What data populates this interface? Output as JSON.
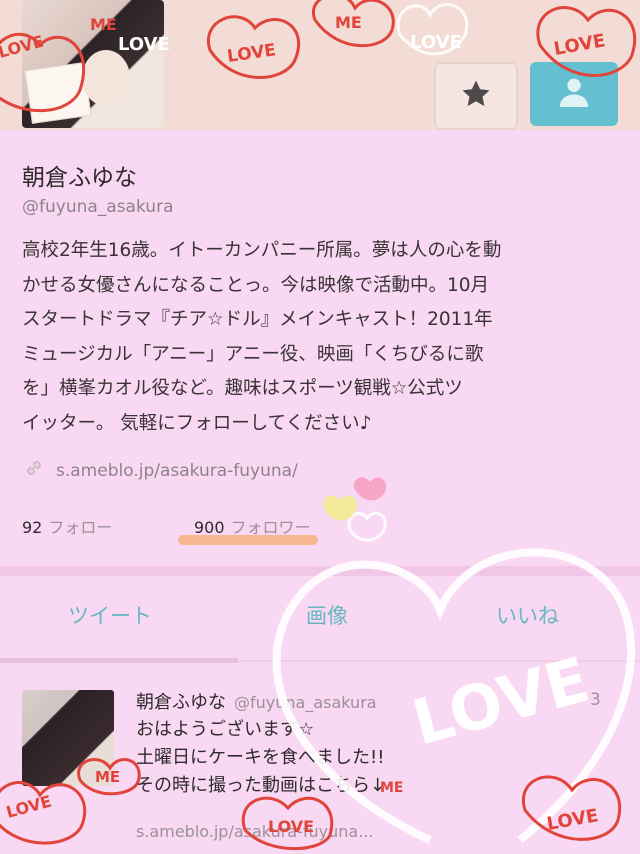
{
  "profile": {
    "name": "朝倉ふゆな",
    "handle": "@fuyuna_asakura",
    "bio": "高校2年生16歳。イトーカンパニー所属。夢は人の心を動\nかせる女優さんになることっ。今は映像で活動中。10月\nスタートドラマ『チア☆ドル』メインキャスト！2011年\nミュージカル「アニー」アニー役、映画「くちびるに歌\nを」横峯カオル役など。趣味はスポーツ観戦☆公式ツ\nイッター。 気軽にフォローしてください♪",
    "link": "s.ameblo.jp/asakura-fuyuna/"
  },
  "stats": {
    "following_count": "92",
    "following_label": "フォロー",
    "followers_count": "900",
    "followers_label": "フォロワー"
  },
  "tabs": [
    {
      "label": "ツイート"
    },
    {
      "label": "画像"
    },
    {
      "label": "いいね"
    }
  ],
  "tweet": {
    "name": "朝倉ふゆな",
    "handle": "@fuyuna_asakura",
    "time": "3",
    "text": "おはようございます☆\n土曜日にケーキを食べました!!\nその時に撮った動画はこちら↓",
    "link": "s.ameblo.jp/asakura-fuyuna..."
  },
  "stickers": {
    "love": "LOVE",
    "me": "ME"
  },
  "icons": {
    "star": "star-icon",
    "follow": "person-icon",
    "link": "link-icon"
  },
  "colors": {
    "background": "#f8d8f2",
    "accent": "#64c0d0",
    "highlight": "#f4b07f",
    "sticker_red": "#e0443a"
  }
}
